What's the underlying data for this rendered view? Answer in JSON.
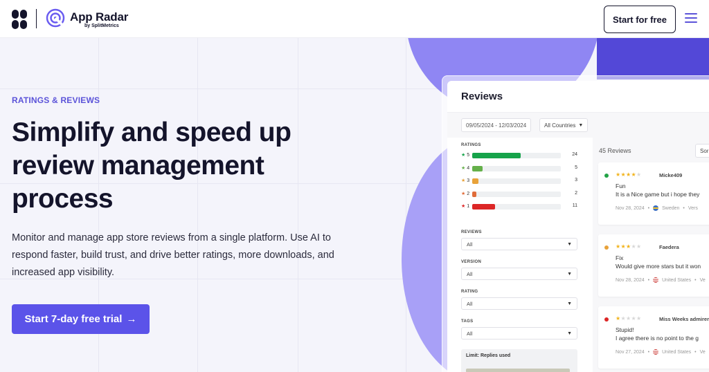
{
  "header": {
    "brand_name": "App Radar",
    "brand_sub": "by SplitMetrics",
    "cta_label": "Start for free"
  },
  "hero": {
    "eyebrow": "RATINGS & REVIEWS",
    "headline_line1": "Simplify and speed up",
    "headline_line2": "review management",
    "headline_line3": "process",
    "subtext": "Monitor and manage app store reviews from a single platform. Use AI to respond faster, build trust, and drive better ratings, more downloads, and increased app visibility.",
    "cta_label": "Start 7-day free trial",
    "cta_arrow": "→"
  },
  "reviews_panel": {
    "title": "Reviews",
    "date_range": "09/05/2024 - 12/03/2024",
    "country_filter": "All Countries",
    "ratings_label": "RATINGS",
    "ratings": [
      {
        "stars": "5",
        "count": "24",
        "color": "#16a34a",
        "fraction": 0.55
      },
      {
        "stars": "4",
        "count": "5",
        "color": "#65b04a",
        "fraction": 0.12
      },
      {
        "stars": "3",
        "count": "3",
        "color": "#e8a23a",
        "fraction": 0.07
      },
      {
        "stars": "2",
        "count": "2",
        "color": "#e06c3a",
        "fraction": 0.05
      },
      {
        "stars": "1",
        "count": "11",
        "color": "#dc2626",
        "fraction": 0.26
      }
    ],
    "filters": [
      {
        "label": "REVIEWS",
        "value": "All"
      },
      {
        "label": "VERSION",
        "value": "All"
      },
      {
        "label": "RATING",
        "value": "All"
      },
      {
        "label": "TAGS",
        "value": "All"
      }
    ],
    "limit_label": "Limit: Replies used",
    "review_count": "45 Reviews",
    "sort_label": "Sor",
    "reviews": [
      {
        "dot_color": "#22a346",
        "rating": 4,
        "author": "Micke409",
        "title": "Fun",
        "text": "It is a Nice game but i hope they",
        "date": "Nov 28, 2024",
        "country": "Sweden",
        "extra": "Vers"
      },
      {
        "dot_color": "#e8a23a",
        "rating": 3,
        "author": "Faedera",
        "title": "Fix",
        "text": "Would give more stars but it won",
        "date": "Nov 28, 2024",
        "country": "United States",
        "extra": "Ve"
      },
      {
        "dot_color": "#dc2626",
        "rating": 1,
        "author": "Miss Weeks admirer",
        "title": "Stupid!",
        "text": "I agree there is no point to the g",
        "date": "Nov 27, 2024",
        "country": "United States",
        "extra": "Ve"
      }
    ]
  }
}
